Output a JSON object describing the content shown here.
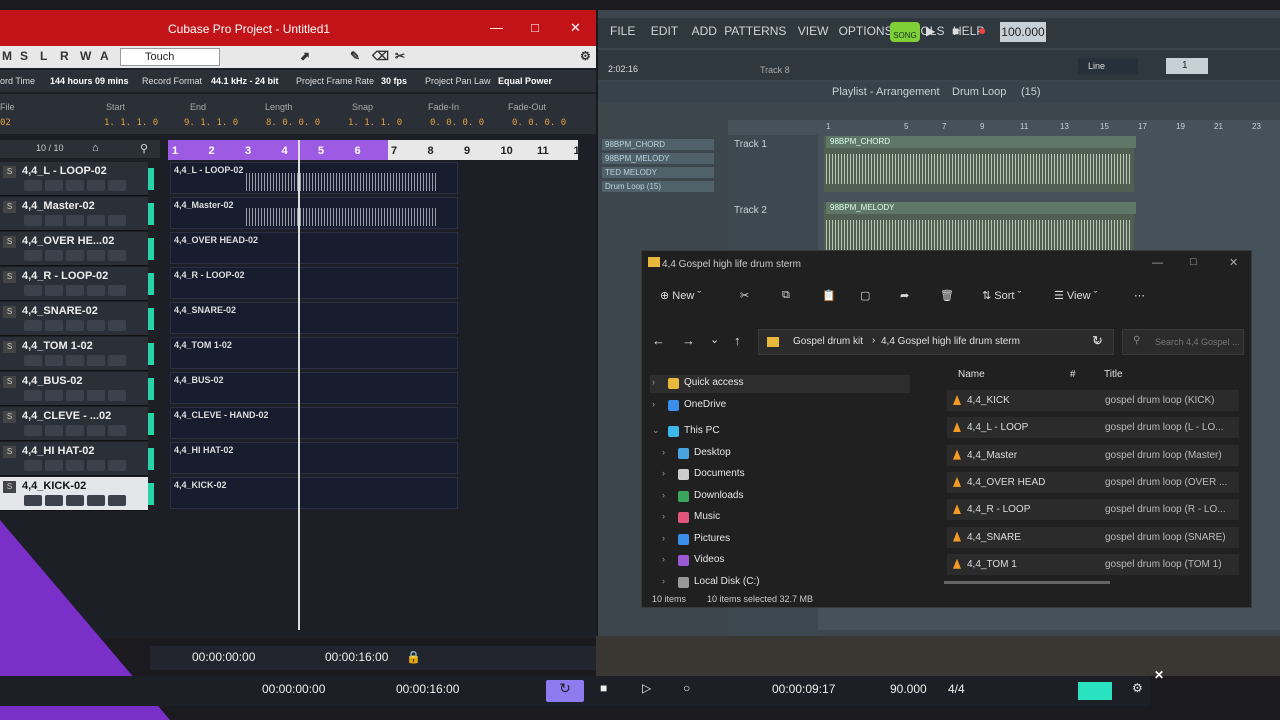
{
  "cubase": {
    "title": "Cubase Pro Project - Untitled1",
    "toolbar": {
      "modes": [
        "M",
        "S",
        "L",
        "R",
        "W",
        "A"
      ],
      "automation_mode": "Touch"
    },
    "info": {
      "record_time_label": "ord Time",
      "record_time": "144 hours 09 mins",
      "record_format_label": "Record Format",
      "record_format": "44.1 kHz - 24 bit",
      "frame_rate_label": "Project Frame Rate",
      "frame_rate": "30 fps",
      "pan_law_label": "Project Pan Law",
      "pan_law": "Equal Power"
    },
    "ruler_info": {
      "file_label": "File",
      "file_value": "02",
      "start_label": "Start",
      "start": "1. 1. 1. 0",
      "end_label": "End",
      "end": "9. 1. 1. 0",
      "length_label": "Length",
      "length": "8. 0. 0. 0",
      "snap_label": "Snap",
      "snap": "1. 1. 1. 0",
      "fadein_label": "Fade-In",
      "fadein": "0. 0. 0. 0",
      "fadeout_label": "Fade-Out",
      "fadeout": "0. 0. 0. 0"
    },
    "track_count": "10 / 10",
    "ruler": [
      "1",
      "2",
      "3",
      "4",
      "5",
      "6",
      "7",
      "8",
      "9",
      "10",
      "11",
      "1"
    ],
    "tracks": [
      {
        "name": "4,4_L - LOOP-02",
        "clip": "4,4_L - LOOP-02"
      },
      {
        "name": "4,4_Master-02",
        "clip": "4,4_Master-02"
      },
      {
        "name": "4,4_OVER HE...02",
        "clip": "4,4_OVER HEAD-02"
      },
      {
        "name": "4,4_R - LOOP-02",
        "clip": "4,4_R - LOOP-02"
      },
      {
        "name": "4,4_SNARE-02",
        "clip": "4,4_SNARE-02"
      },
      {
        "name": "4,4_TOM 1-02",
        "clip": "4,4_TOM 1-02"
      },
      {
        "name": "4,4_BUS-02",
        "clip": "4,4_BUS-02"
      },
      {
        "name": "4,4_CLEVE - ...02",
        "clip": "4,4_CLEVE - HAND-02"
      },
      {
        "name": "4,4_HI HAT-02",
        "clip": "4,4_HI HAT-02"
      },
      {
        "name": "4,4_KICK-02",
        "clip": "4,4_KICK-02"
      }
    ],
    "transport": {
      "left": "00:00:00:00",
      "right": "00:00:16:00"
    }
  },
  "fl": {
    "menu": [
      "FILE",
      "EDIT",
      "ADD",
      "PATTERNS",
      "VIEW",
      "OPTIONS",
      "TOOLS",
      "HELP"
    ],
    "song_label": "SONG",
    "tempo": "100.000",
    "time": "2:02:16",
    "track_label": "Track 8",
    "line_mode": "Line",
    "snap_value": "1",
    "playlist_title": "Playlist - Arrangement",
    "playlist_pattern": "Drum Loop",
    "playlist_count": "(15)",
    "channels": [
      "98BPM_CHORD",
      "98BPM_MELODY",
      "TED MELODY",
      "Drum Loop (15)"
    ],
    "bar_numbers": [
      "1",
      "5",
      "7",
      "9",
      "11",
      "13",
      "15",
      "17",
      "19",
      "21",
      "23"
    ],
    "tracks": [
      {
        "label": "Track 1",
        "clip": "98BPM_CHORD"
      },
      {
        "label": "Track 2",
        "clip": "98BPM_MELODY"
      }
    ]
  },
  "explorer": {
    "title": "4,4 Gospel high life drum sterm",
    "new_label": "New",
    "sort_label": "Sort",
    "view_label": "View",
    "breadcrumb": [
      "Gospel drum kit",
      "4,4 Gospel high life drum sterm"
    ],
    "search_placeholder": "Search 4,4 Gospel ...",
    "nav": [
      "Quick access",
      "OneDrive",
      "This PC",
      "Desktop",
      "Documents",
      "Downloads",
      "Music",
      "Pictures",
      "Videos",
      "Local Disk (C:)"
    ],
    "columns": {
      "name": "Name",
      "num": "#",
      "title": "Title"
    },
    "files": [
      {
        "name": "4,4_KICK",
        "title": "gospel drum loop (KICK)"
      },
      {
        "name": "4,4_L - LOOP",
        "title": "gospel drum loop (L - LO..."
      },
      {
        "name": "4,4_Master",
        "title": "gospel drum loop (Master)"
      },
      {
        "name": "4,4_OVER HEAD",
        "title": "gospel drum loop (OVER ..."
      },
      {
        "name": "4,4_R - LOOP",
        "title": "gospel drum loop (R - LO..."
      },
      {
        "name": "4,4_SNARE",
        "title": "gospel drum loop (SNARE)"
      },
      {
        "name": "4,4_TOM 1",
        "title": "gospel drum loop (TOM 1)"
      }
    ],
    "status_items": "10 items",
    "status_selected": "10 items selected  32.7 MB"
  },
  "bottom": {
    "t1": "00:00:00:00",
    "t2": "00:00:16:00",
    "t3": "00:00:09:17",
    "bpm": "90.000",
    "sig": "4/4"
  }
}
